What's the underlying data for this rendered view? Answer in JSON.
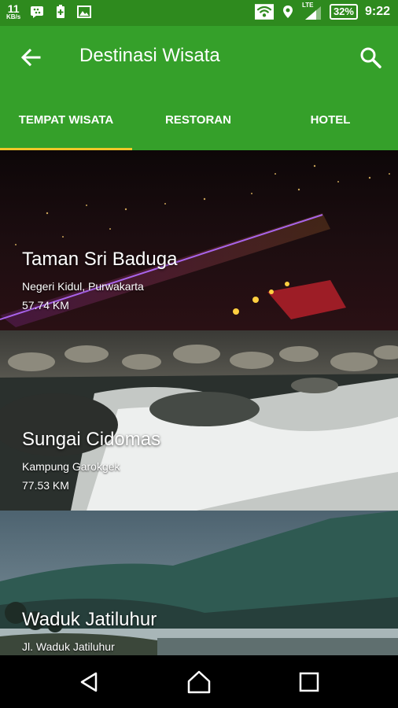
{
  "status_bar": {
    "net_speed": "11",
    "net_unit": "KB/s",
    "network": "LTE",
    "battery": "32%",
    "time": "9:22"
  },
  "app_bar": {
    "title": "Destinasi Wisata",
    "back_icon": "arrow-back-icon",
    "search_icon": "search-icon"
  },
  "tabs": [
    {
      "label": "TEMPAT WISATA",
      "selected": true
    },
    {
      "label": "RESTORAN",
      "selected": false
    },
    {
      "label": "HOTEL",
      "selected": false
    }
  ],
  "places": [
    {
      "name": "Taman Sri Baduga",
      "address": "Negeri Kidul, Purwakarta",
      "distance": "57.74 KM"
    },
    {
      "name": "Sungai Cidomas",
      "address": "Kampung Garokgek",
      "distance": "77.53 KM"
    },
    {
      "name": "Waduk Jatiluhur",
      "address": "Jl. Waduk Jatiluhur",
      "distance": ""
    }
  ],
  "colors": {
    "status_bar": "#2e8a1e",
    "app_bar": "#35a02a",
    "tab_indicator": "#f2c629"
  }
}
